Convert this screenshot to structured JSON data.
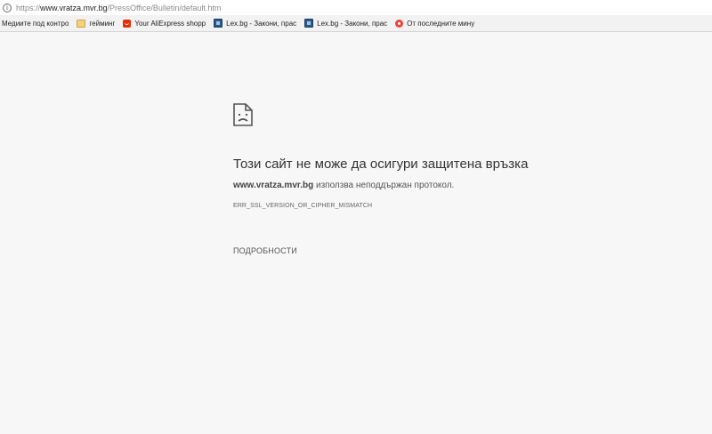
{
  "address_bar": {
    "url_scheme": "https://",
    "url_host": "www.vratza.mvr.bg",
    "url_path": "/PressOffice/Bulletin/default.htm"
  },
  "bookmarks": [
    {
      "label": "Медиите под контро",
      "icon": "none"
    },
    {
      "label": "гейминг",
      "icon": "folder-icon"
    },
    {
      "label": "Your AliExpress shopp",
      "icon": "aliexpress-icon"
    },
    {
      "label": "Lex.bg - Закони, прас",
      "icon": "lex-icon"
    },
    {
      "label": "Lex.bg - Закони, прас",
      "icon": "lex-icon"
    },
    {
      "label": "От последните мину",
      "icon": "news-icon"
    }
  ],
  "error": {
    "title": "Този сайт не може да осигури защитена връзка",
    "domain": "www.vratza.mvr.bg",
    "description": " използва неподдържан протокол.",
    "code": "ERR_SSL_VERSION_OR_CIPHER_MISMATCH",
    "details_label": "ПОДРОБНОСТИ"
  }
}
